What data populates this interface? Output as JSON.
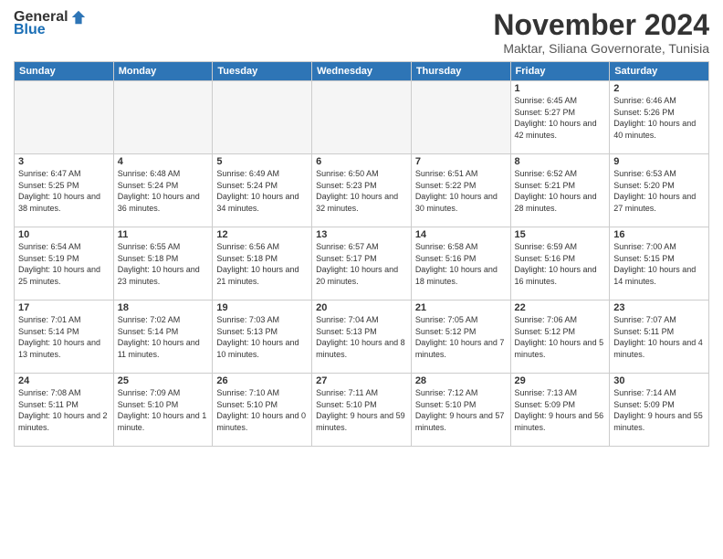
{
  "logo": {
    "general": "General",
    "blue": "Blue"
  },
  "title": "November 2024",
  "location": "Maktar, Siliana Governorate, Tunisia",
  "days": [
    "Sunday",
    "Monday",
    "Tuesday",
    "Wednesday",
    "Thursday",
    "Friday",
    "Saturday"
  ],
  "weeks": [
    [
      {
        "day": "",
        "content": ""
      },
      {
        "day": "",
        "content": ""
      },
      {
        "day": "",
        "content": ""
      },
      {
        "day": "",
        "content": ""
      },
      {
        "day": "",
        "content": ""
      },
      {
        "day": "1",
        "content": "Sunrise: 6:45 AM\nSunset: 5:27 PM\nDaylight: 10 hours and 42 minutes."
      },
      {
        "day": "2",
        "content": "Sunrise: 6:46 AM\nSunset: 5:26 PM\nDaylight: 10 hours and 40 minutes."
      }
    ],
    [
      {
        "day": "3",
        "content": "Sunrise: 6:47 AM\nSunset: 5:25 PM\nDaylight: 10 hours and 38 minutes."
      },
      {
        "day": "4",
        "content": "Sunrise: 6:48 AM\nSunset: 5:24 PM\nDaylight: 10 hours and 36 minutes."
      },
      {
        "day": "5",
        "content": "Sunrise: 6:49 AM\nSunset: 5:24 PM\nDaylight: 10 hours and 34 minutes."
      },
      {
        "day": "6",
        "content": "Sunrise: 6:50 AM\nSunset: 5:23 PM\nDaylight: 10 hours and 32 minutes."
      },
      {
        "day": "7",
        "content": "Sunrise: 6:51 AM\nSunset: 5:22 PM\nDaylight: 10 hours and 30 minutes."
      },
      {
        "day": "8",
        "content": "Sunrise: 6:52 AM\nSunset: 5:21 PM\nDaylight: 10 hours and 28 minutes."
      },
      {
        "day": "9",
        "content": "Sunrise: 6:53 AM\nSunset: 5:20 PM\nDaylight: 10 hours and 27 minutes."
      }
    ],
    [
      {
        "day": "10",
        "content": "Sunrise: 6:54 AM\nSunset: 5:19 PM\nDaylight: 10 hours and 25 minutes."
      },
      {
        "day": "11",
        "content": "Sunrise: 6:55 AM\nSunset: 5:18 PM\nDaylight: 10 hours and 23 minutes."
      },
      {
        "day": "12",
        "content": "Sunrise: 6:56 AM\nSunset: 5:18 PM\nDaylight: 10 hours and 21 minutes."
      },
      {
        "day": "13",
        "content": "Sunrise: 6:57 AM\nSunset: 5:17 PM\nDaylight: 10 hours and 20 minutes."
      },
      {
        "day": "14",
        "content": "Sunrise: 6:58 AM\nSunset: 5:16 PM\nDaylight: 10 hours and 18 minutes."
      },
      {
        "day": "15",
        "content": "Sunrise: 6:59 AM\nSunset: 5:16 PM\nDaylight: 10 hours and 16 minutes."
      },
      {
        "day": "16",
        "content": "Sunrise: 7:00 AM\nSunset: 5:15 PM\nDaylight: 10 hours and 14 minutes."
      }
    ],
    [
      {
        "day": "17",
        "content": "Sunrise: 7:01 AM\nSunset: 5:14 PM\nDaylight: 10 hours and 13 minutes."
      },
      {
        "day": "18",
        "content": "Sunrise: 7:02 AM\nSunset: 5:14 PM\nDaylight: 10 hours and 11 minutes."
      },
      {
        "day": "19",
        "content": "Sunrise: 7:03 AM\nSunset: 5:13 PM\nDaylight: 10 hours and 10 minutes."
      },
      {
        "day": "20",
        "content": "Sunrise: 7:04 AM\nSunset: 5:13 PM\nDaylight: 10 hours and 8 minutes."
      },
      {
        "day": "21",
        "content": "Sunrise: 7:05 AM\nSunset: 5:12 PM\nDaylight: 10 hours and 7 minutes."
      },
      {
        "day": "22",
        "content": "Sunrise: 7:06 AM\nSunset: 5:12 PM\nDaylight: 10 hours and 5 minutes."
      },
      {
        "day": "23",
        "content": "Sunrise: 7:07 AM\nSunset: 5:11 PM\nDaylight: 10 hours and 4 minutes."
      }
    ],
    [
      {
        "day": "24",
        "content": "Sunrise: 7:08 AM\nSunset: 5:11 PM\nDaylight: 10 hours and 2 minutes."
      },
      {
        "day": "25",
        "content": "Sunrise: 7:09 AM\nSunset: 5:10 PM\nDaylight: 10 hours and 1 minute."
      },
      {
        "day": "26",
        "content": "Sunrise: 7:10 AM\nSunset: 5:10 PM\nDaylight: 10 hours and 0 minutes."
      },
      {
        "day": "27",
        "content": "Sunrise: 7:11 AM\nSunset: 5:10 PM\nDaylight: 9 hours and 59 minutes."
      },
      {
        "day": "28",
        "content": "Sunrise: 7:12 AM\nSunset: 5:10 PM\nDaylight: 9 hours and 57 minutes."
      },
      {
        "day": "29",
        "content": "Sunrise: 7:13 AM\nSunset: 5:09 PM\nDaylight: 9 hours and 56 minutes."
      },
      {
        "day": "30",
        "content": "Sunrise: 7:14 AM\nSunset: 5:09 PM\nDaylight: 9 hours and 55 minutes."
      }
    ]
  ]
}
